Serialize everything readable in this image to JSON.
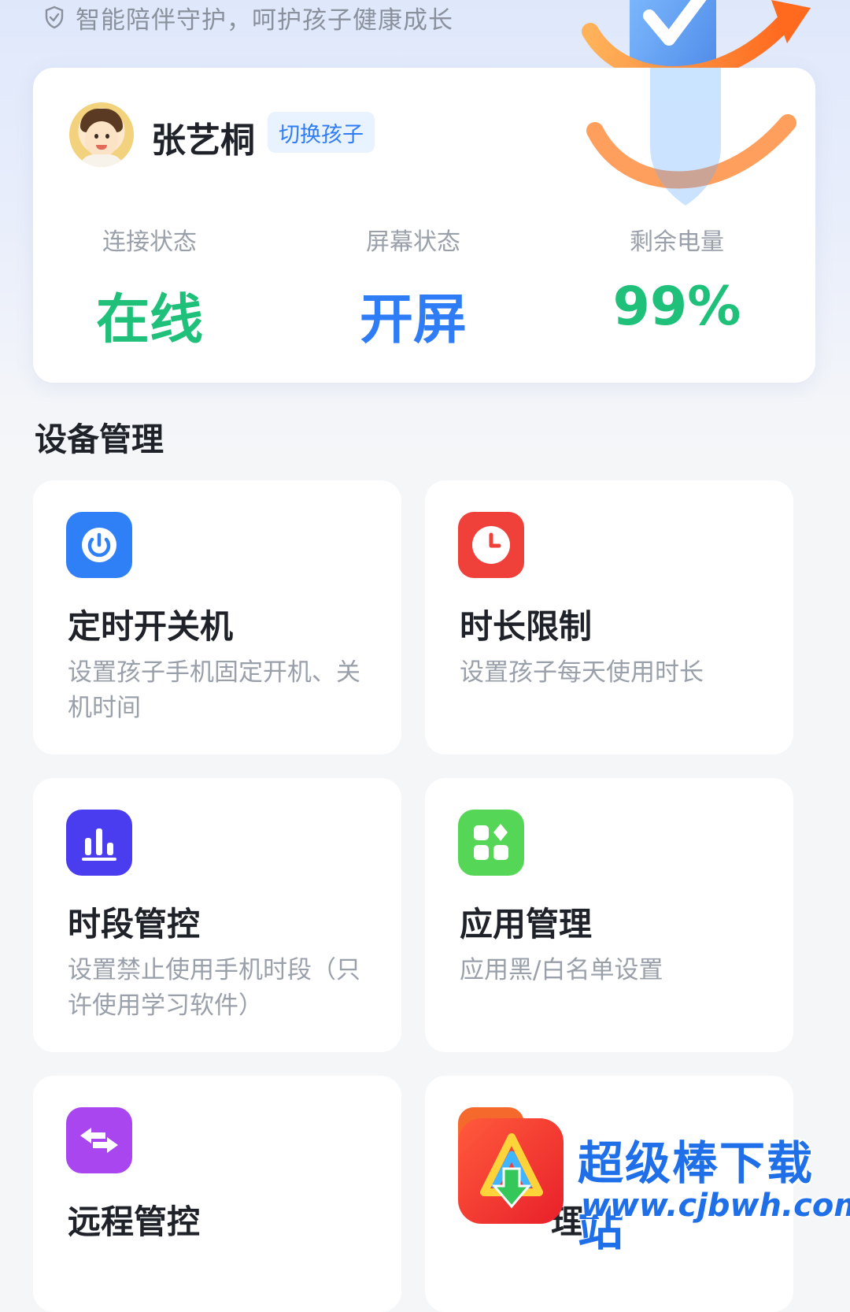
{
  "header": {
    "tagline": "智能陪伴守护，呵护孩子健康成长",
    "tagline_icon": "shield-check-icon"
  },
  "child": {
    "name": "张艺桐",
    "switch_label": "切换孩子",
    "avatar": "child-avatar"
  },
  "status": [
    {
      "label": "连接状态",
      "value": "在线",
      "color": "#1fc07a"
    },
    {
      "label": "屏幕状态",
      "value": "开屏",
      "color": "#2f7df6"
    },
    {
      "label": "剩余电量",
      "value": "99%",
      "color": "#1fc07a"
    }
  ],
  "device_management": {
    "title": "设备管理",
    "tiles": [
      {
        "title": "定时开关机",
        "desc": "设置孩子手机固定开机、关机时间",
        "icon": "power-icon",
        "icon_color": "#2f80f7"
      },
      {
        "title": "时长限制",
        "desc": "设置孩子每天使用时长",
        "icon": "clock-icon",
        "icon_color": "#f0403a"
      },
      {
        "title": "时段管控",
        "desc": "设置禁止使用手机时段（只许使用学习软件）",
        "icon": "bar-chart-icon",
        "icon_color": "#4a3df0"
      },
      {
        "title": "应用管理",
        "desc": "应用黑/白名单设置",
        "icon": "apps-grid-icon",
        "icon_color": "#55d656"
      },
      {
        "title": "远程管控",
        "desc": "",
        "icon": "swap-arrows-icon",
        "icon_color": "#a946f0"
      },
      {
        "title": "理",
        "desc": "",
        "icon": "partial-icon",
        "icon_color": "#f5692d"
      }
    ]
  },
  "watermark": {
    "title": "超级棒下载站",
    "url": "www.cjbwh.com"
  }
}
